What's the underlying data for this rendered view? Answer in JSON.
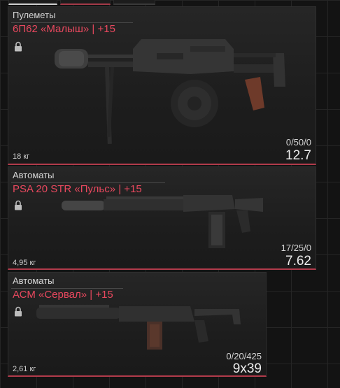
{
  "weapons": [
    {
      "category": "Пулеметы",
      "title": "6П62 «Малыш» | +15",
      "weight": "18 кг",
      "ammo": "0/50/0",
      "caliber": "12.7",
      "icon": "lock-icon"
    },
    {
      "category": "Автоматы",
      "title": "PSA 20 STR «Пульс» | +15",
      "weight": "4,95 кг",
      "ammo": "17/25/0",
      "caliber": "7.62",
      "icon": "lock-icon"
    },
    {
      "category": "Автоматы",
      "title": "АСМ «Сервал» | +15",
      "weight": "2,61 кг",
      "ammo": "0/20/425",
      "caliber": "9x39",
      "icon": "lock-icon"
    }
  ],
  "colors": {
    "accent": "#e8485e",
    "border_accent": "#b23b4b"
  }
}
